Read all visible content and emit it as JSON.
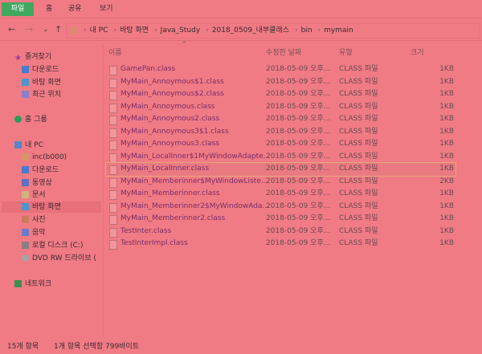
{
  "ribbon": {
    "file": "파일",
    "tabs": [
      "홈",
      "공유",
      "보기"
    ]
  },
  "nav": {
    "back": "←",
    "forward": "→",
    "history": "⌄",
    "up": "↑"
  },
  "address": {
    "crumbs": [
      "내 PC",
      "바탕 화면",
      "Java_Study",
      "2018_0509_내부클래스",
      "bin",
      "mymain"
    ]
  },
  "sidebar": {
    "favorites": "즐겨찾기",
    "fav_items": [
      "다운로드",
      "바탕 화면",
      "최근 위치"
    ],
    "homegroup": "홈 그룹",
    "this_pc": "내 PC",
    "pc_items": [
      "inc(b000)",
      "다운로드",
      "동영상",
      "문서",
      "바탕 화면",
      "사진",
      "음악",
      "로컬 디스크 (C:)",
      "DVD RW 드라이브 ("
    ],
    "network": "네트워크"
  },
  "columns": {
    "name": "이름",
    "date": "수정한 날짜",
    "type": "유형",
    "size": "크기"
  },
  "files": [
    {
      "name": "GamePan.class",
      "date": "2018-05-09 오후...",
      "type": "CLASS 파일",
      "size": "1KB"
    },
    {
      "name": "MyMain_Annoymous$1.class",
      "date": "2018-05-09 오후...",
      "type": "CLASS 파일",
      "size": "1KB"
    },
    {
      "name": "MyMain_Annoymous$2.class",
      "date": "2018-05-09 오후...",
      "type": "CLASS 파일",
      "size": "1KB"
    },
    {
      "name": "MyMain_Annoymous.class",
      "date": "2018-05-09 오후...",
      "type": "CLASS 파일",
      "size": "1KB"
    },
    {
      "name": "MyMain_Annoymous2.class",
      "date": "2018-05-09 오후...",
      "type": "CLASS 파일",
      "size": "1KB"
    },
    {
      "name": "MyMain_Annoymous3$1.class",
      "date": "2018-05-09 오후...",
      "type": "CLASS 파일",
      "size": "1KB"
    },
    {
      "name": "MyMain_Annoymous3.class",
      "date": "2018-05-09 오후...",
      "type": "CLASS 파일",
      "size": "1KB"
    },
    {
      "name": "MyMain_LocalInner$1MyWindowAdapte...",
      "date": "2018-05-09 오후...",
      "type": "CLASS 파일",
      "size": "1KB"
    },
    {
      "name": "MyMain_LocalInner.class",
      "date": "2018-05-09 오후...",
      "type": "CLASS 파일",
      "size": "1KB"
    },
    {
      "name": "MyMain_Memberinner$MyWindowListe...",
      "date": "2018-05-09 오후...",
      "type": "CLASS 파일",
      "size": "2KB"
    },
    {
      "name": "MyMain_Memberinner.class",
      "date": "2018-05-09 오후...",
      "type": "CLASS 파일",
      "size": "1KB"
    },
    {
      "name": "MyMain_Memberinner2$MyWindowAda...",
      "date": "2018-05-09 오후...",
      "type": "CLASS 파일",
      "size": "1KB"
    },
    {
      "name": "MyMain_Memberinner2.class",
      "date": "2018-05-09 오후...",
      "type": "CLASS 파일",
      "size": "1KB"
    },
    {
      "name": "TestInter.class",
      "date": "2018-05-09 오후...",
      "type": "CLASS 파일",
      "size": "1KB"
    },
    {
      "name": "TestInterImpl.class",
      "date": "2018-05-09 오후...",
      "type": "CLASS 파일",
      "size": "1KB"
    }
  ],
  "selected_index": 8,
  "status": {
    "count": "15개 항목",
    "selection": "1개 항목 선택함 799바이트"
  }
}
